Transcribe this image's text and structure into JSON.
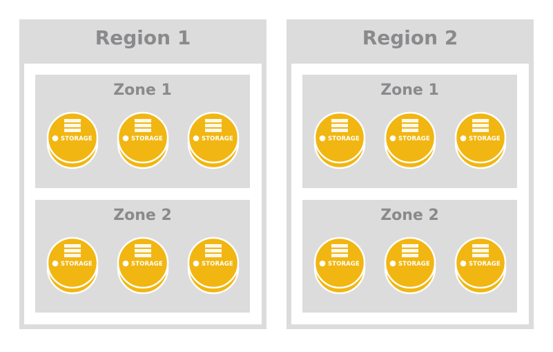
{
  "regions": [
    {
      "title": "Region 1",
      "zones": [
        {
          "title": "Zone 1",
          "nodes": [
            "STORAGE",
            "STORAGE",
            "STORAGE"
          ]
        },
        {
          "title": "Zone 2",
          "nodes": [
            "STORAGE",
            "STORAGE",
            "STORAGE"
          ]
        }
      ]
    },
    {
      "title": "Region 2",
      "zones": [
        {
          "title": "Zone 1",
          "nodes": [
            "STORAGE",
            "STORAGE",
            "STORAGE"
          ]
        },
        {
          "title": "Zone 2",
          "nodes": [
            "STORAGE",
            "STORAGE",
            "STORAGE"
          ]
        }
      ]
    }
  ],
  "icons": {
    "storage": "storage-disk-icon"
  },
  "colors": {
    "region_bg": "#dcdcdd",
    "zone_bg": "#dcdcdd",
    "title_text": "#8a8a8c",
    "disk_fill": "#f1b611",
    "disk_stroke": "#ffffff"
  }
}
